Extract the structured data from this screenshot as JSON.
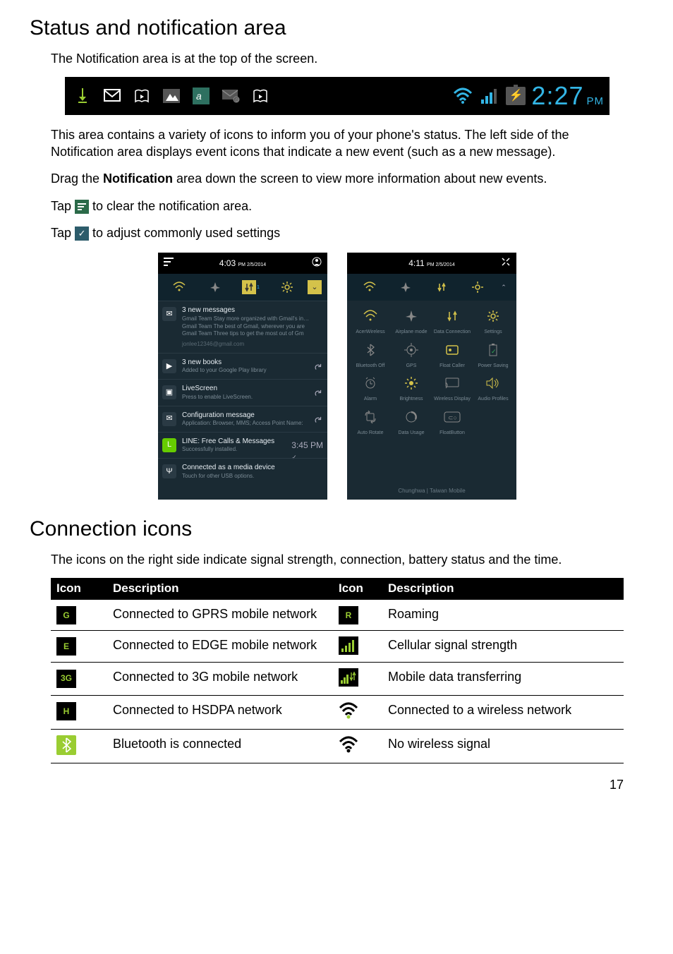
{
  "section1": {
    "title": "Status and notification area",
    "intro": "The Notification area is at the top of the screen.",
    "clock_time": "2:27",
    "clock_suffix": "PM",
    "para1": "This area contains a variety of icons to inform you of your phone's status. The left side of the Notification area displays event icons that indicate a new event (such as a new message).",
    "para2_prefix": "Drag the ",
    "para2_bold": "Notification",
    "para2_suffix": " area down the screen to view more information about new events.",
    "tap_clear_prefix": "Tap ",
    "tap_clear_suffix": " to clear the notification area.",
    "tap_adjust_prefix": "Tap ",
    "tap_adjust_suffix": " to adjust commonly used settings"
  },
  "left_panel": {
    "header_time": "4:03",
    "header_suffix": "PM 2/5/2014",
    "items": [
      {
        "icon": "✉",
        "title": "3 new messages",
        "sub1": "Gmail Team  Stay more organized with Gmail's in…",
        "sub2": "Gmail Team  The best of Gmail, wherever you are",
        "sub3": "Gmail Team  Three tips to get the most out of Gm",
        "foot": "jonlee12346@gmail.com"
      },
      {
        "icon": "▶",
        "title": "3 new books",
        "sub": "Added to your Google Play library"
      },
      {
        "icon": "▣",
        "title": "LiveScreen",
        "sub": "Press to enable LiveScreen."
      },
      {
        "icon": "✉",
        "title": "Configuration message",
        "sub": "Application: Browser, MMS; Access Point Name:"
      },
      {
        "icon": "L",
        "icon_bg": "#6c0",
        "title": "LINE: Free Calls & Messages",
        "sub": "Successfully installed.",
        "meta": "3:45 PM"
      },
      {
        "icon": "Ψ",
        "title": "Connected as a media device",
        "sub": "Touch for other USB options."
      }
    ]
  },
  "right_panel": {
    "header_time": "4:11",
    "header_suffix": "PM 2/5/2014",
    "tiles": [
      {
        "label": "AcerWireless",
        "glyph": "wifi",
        "accent": true
      },
      {
        "label": "Airplane mode",
        "glyph": "plane"
      },
      {
        "label": "Data Connection",
        "glyph": "updown",
        "accent": true
      },
      {
        "label": "Settings",
        "glyph": "gear",
        "accent": true
      },
      {
        "label": "Bluetooth Off",
        "glyph": "bt"
      },
      {
        "label": "GPS",
        "glyph": "target"
      },
      {
        "label": "Float Caller",
        "glyph": "float",
        "accent": true
      },
      {
        "label": "Power Saving",
        "glyph": "battery"
      },
      {
        "label": "Alarm",
        "glyph": "alarm"
      },
      {
        "label": "Brightness",
        "glyph": "bright",
        "accent": true
      },
      {
        "label": "Wireless Display",
        "glyph": "cast"
      },
      {
        "label": "Audio Profiles",
        "glyph": "sound",
        "accent": true
      },
      {
        "label": "Auto Rotate",
        "glyph": "rotate"
      },
      {
        "label": "Data Usage",
        "glyph": "usage"
      },
      {
        "label": "FloatButton",
        "glyph": "fbtn"
      },
      {
        "label": "",
        "glyph": ""
      }
    ],
    "footer": "Chunghwa | Taiwan Mobile"
  },
  "section2": {
    "title": "Connection icons",
    "intro": "The icons on the right side indicate signal strength, connection, battery status and the time."
  },
  "table": {
    "headers": {
      "icon1": "Icon",
      "desc1": "Description",
      "icon2": "Icon",
      "desc2": "Description"
    },
    "rows": [
      {
        "b1": "G",
        "d1": "Connected to GPRS mobile network",
        "b2": "R",
        "d2": "Roaming"
      },
      {
        "b1": "E",
        "d1": "Connected to EDGE mobile network",
        "b2": "bars",
        "d2": "Cellular signal strength"
      },
      {
        "b1": "3G",
        "d1": "Connected to 3G mobile network",
        "b2": "data",
        "d2": "Mobile data transferring"
      },
      {
        "b1": "H",
        "d1": "Connected to HSDPA network",
        "b2": "wifi-dot",
        "d2": "Connected to a wireless network"
      },
      {
        "b1": "bt",
        "d1": "Bluetooth is connected",
        "b2": "wifi-nodot",
        "d2": "No wireless signal"
      }
    ]
  },
  "page_number": "17"
}
